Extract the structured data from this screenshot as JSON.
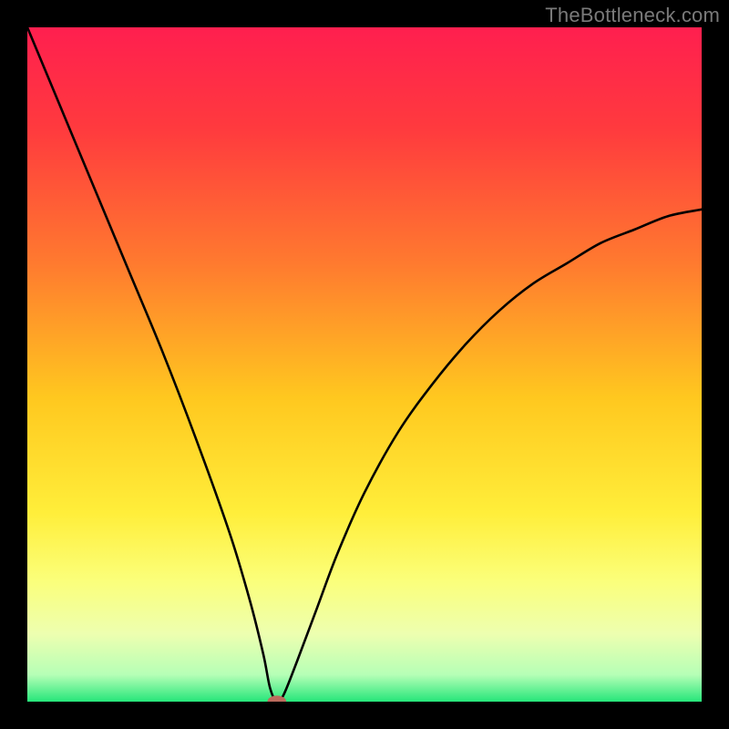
{
  "watermark": "TheBottleneck.com",
  "colors": {
    "frame": "#000000",
    "watermark": "#7a7a7a",
    "curve": "#000000",
    "marker_fill": "#bb6b5d",
    "gradient_stops": [
      {
        "offset": 0.0,
        "color": "#ff1f4f"
      },
      {
        "offset": 0.15,
        "color": "#ff3a3e"
      },
      {
        "offset": 0.35,
        "color": "#ff7a2f"
      },
      {
        "offset": 0.55,
        "color": "#ffc81f"
      },
      {
        "offset": 0.72,
        "color": "#ffee3a"
      },
      {
        "offset": 0.82,
        "color": "#fbff7a"
      },
      {
        "offset": 0.9,
        "color": "#edffb0"
      },
      {
        "offset": 0.96,
        "color": "#b6ffb6"
      },
      {
        "offset": 1.0,
        "color": "#26e67a"
      }
    ]
  },
  "chart_data": {
    "type": "line",
    "title": "",
    "xlabel": "",
    "ylabel": "",
    "xlim": [
      0,
      100
    ],
    "ylim": [
      0,
      100
    ],
    "optimum_x": 37,
    "series": [
      {
        "name": "bottleneck-curve",
        "x": [
          0,
          5,
          10,
          15,
          20,
          25,
          30,
          33,
          35,
          36,
          37,
          38,
          40,
          43,
          46,
          50,
          55,
          60,
          65,
          70,
          75,
          80,
          85,
          90,
          95,
          100
        ],
        "values": [
          100,
          88,
          76,
          64,
          52,
          39,
          25,
          15,
          7,
          2,
          0,
          1,
          6,
          14,
          22,
          31,
          40,
          47,
          53,
          58,
          62,
          65,
          68,
          70,
          72,
          73
        ]
      }
    ],
    "marker": {
      "x": 37,
      "y": 0,
      "rx": 1.4,
      "ry": 0.9
    }
  }
}
